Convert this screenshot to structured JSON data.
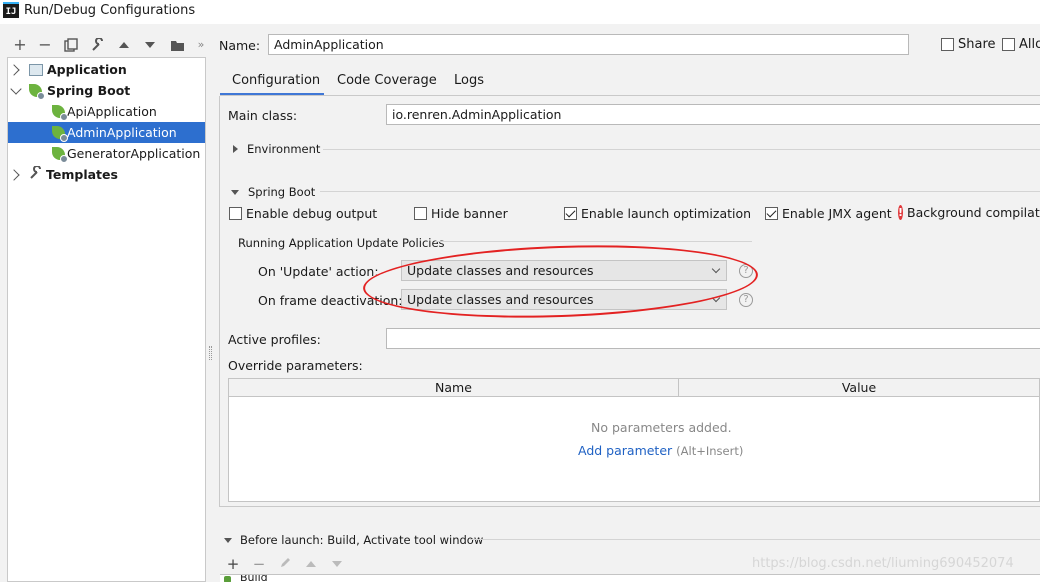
{
  "window": {
    "title": "Run/Debug Configurations",
    "app_logo": "IJ"
  },
  "toolbar": {
    "icons": [
      "plus-icon",
      "minus-icon",
      "copy-icon",
      "wrench-icon",
      "arrow-up-icon",
      "arrow-down-icon",
      "folder-icon",
      "more-icon"
    ]
  },
  "tree": {
    "items": [
      {
        "label": "Application",
        "type": "group",
        "expanded": false
      },
      {
        "label": "Spring Boot",
        "type": "group",
        "expanded": true
      },
      {
        "label": "ApiApplication",
        "type": "leaf"
      },
      {
        "label": "AdminApplication",
        "type": "leaf",
        "selected": true
      },
      {
        "label": "GeneratorApplication",
        "type": "leaf"
      },
      {
        "label": "Templates",
        "type": "group",
        "expanded": false
      }
    ]
  },
  "header": {
    "name_label": "Name:",
    "name_value": "AdminApplication",
    "share_label": "Share",
    "allow_label": "Allo"
  },
  "tabs": [
    "Configuration",
    "Code Coverage",
    "Logs"
  ],
  "config": {
    "main_class_label": "Main class:",
    "main_class_value": "io.renren.AdminApplication",
    "environment_label": "Environment",
    "spring_boot_label": "Spring Boot",
    "checkboxes": [
      {
        "label": "Enable debug output",
        "checked": false
      },
      {
        "label": "Hide banner",
        "checked": false
      },
      {
        "label": "Enable launch optimization",
        "checked": true
      },
      {
        "label": "Enable JMX agent",
        "checked": true
      }
    ],
    "background_compile_label": "Background compilati",
    "update_policies_label": "Running Application Update Policies",
    "on_update_label": "On 'Update' action:",
    "on_update_value": "Update classes and resources",
    "on_frame_label": "On frame deactivation:",
    "on_frame_value": "Update classes and resources",
    "active_profiles_label": "Active profiles:",
    "active_profiles_value": "",
    "override_label": "Override parameters:",
    "table_columns": [
      "Name",
      "Value"
    ],
    "empty_text": "No parameters added.",
    "add_param_link": "Add parameter",
    "add_param_hint": "(Alt+Insert)"
  },
  "before_launch": {
    "label": "Before launch: Build, Activate tool window",
    "first_item": "Build"
  },
  "watermark": "https://blog.csdn.net/liuming690452074",
  "colors": {
    "selection": "#2d6fcf",
    "link": "#2062c4",
    "annotation": "#e32222",
    "spring_leaf": "#6db33f"
  }
}
